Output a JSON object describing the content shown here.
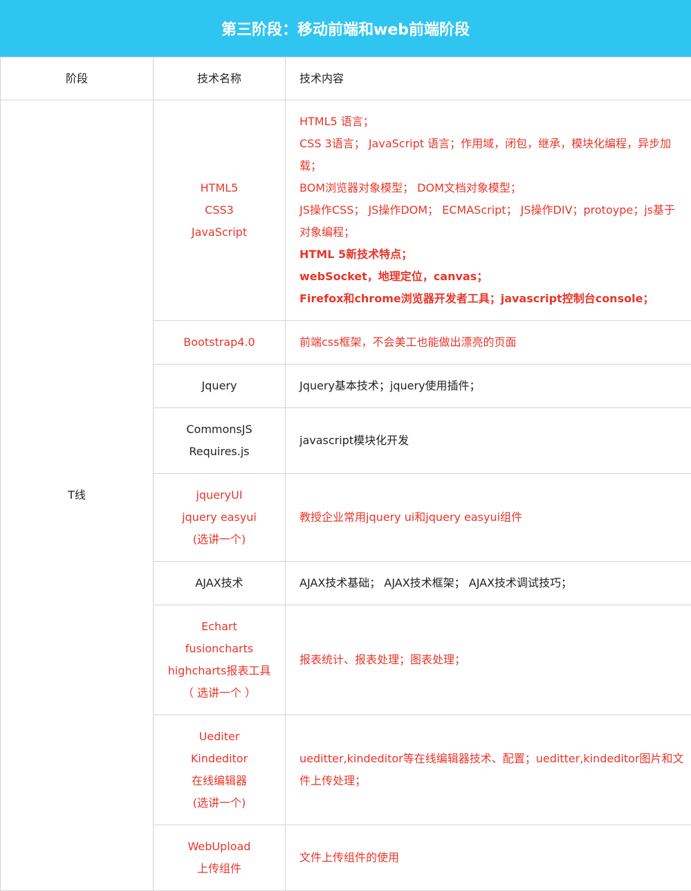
{
  "title": "第三阶段：移动前端和web前端阶段",
  "header": {
    "stage": "阶段",
    "tech_name": "技术名称",
    "tech_content": "技术内容"
  },
  "stage_name": "T线",
  "colors": {
    "banner": "#2ec5f1",
    "red": "#e8352a",
    "border": "#d4d4d4"
  },
  "rows": [
    {
      "names": [
        "HTML5",
        "CSS3",
        "JavaScript"
      ],
      "content": [
        "HTML5 语言；",
        "CSS 3语言； JavaScript 语言；作用域，闭包，继承，模块化编程，异步加载；",
        "BOM浏览器对象模型； DOM文档对象模型；",
        "JS操作CSS； JS操作DOM； ECMAScript； JS操作DIV；protoype；js基于对象编程；",
        "HTML 5新技术特点；",
        "webSocket，地理定位，canvas；",
        "Firefox和chrome浏览器开发者工具；javascript控制台console；"
      ]
    },
    {
      "names": [
        "Bootstrap4.0"
      ],
      "content": [
        "前端css框架，不会美工也能做出漂亮的页面"
      ]
    },
    {
      "names": [
        "Jquery"
      ],
      "content": [
        "Jquery基本技术；jquery使用插件；"
      ]
    },
    {
      "names": [
        "CommonsJS",
        "Requires.js"
      ],
      "content": [
        "javascript模块化开发"
      ]
    },
    {
      "names": [
        "jqueryUI",
        "jquery easyui",
        "(选讲一个)"
      ],
      "content": [
        "教授企业常用jquery ui和jquery easyui组件"
      ]
    },
    {
      "names": [
        "AJAX技术"
      ],
      "content": [
        "AJAX技术基础； AJAX技术框架； AJAX技术调试技巧；"
      ]
    },
    {
      "names": [
        "Echart",
        "fusioncharts",
        "highcharts报表工具",
        "（ 选讲一个 ）"
      ],
      "content": [
        "报表统计、报表处理；图表处理；"
      ]
    },
    {
      "names": [
        "Uediter",
        "Kindeditor",
        "在线编辑器",
        "(选讲一个)"
      ],
      "content": [
        "ueditter,kindeditor等在线编辑器技术、配置；ueditter,kindeditor图片和文件上传处理；"
      ]
    },
    {
      "names": [
        "WebUpload",
        "上传组件"
      ],
      "content": [
        "文件上传组件的使用"
      ]
    }
  ]
}
